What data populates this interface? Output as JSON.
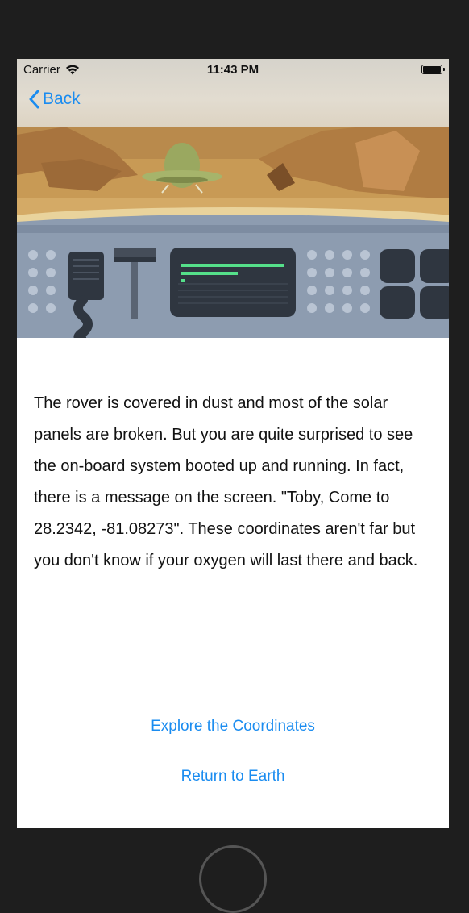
{
  "status_bar": {
    "carrier": "Carrier",
    "time": "11:43 PM"
  },
  "nav": {
    "back_label": "Back"
  },
  "hero": {
    "icon": "mars-rover-cockpit-illustration"
  },
  "story": {
    "text": "The rover is covered in dust and most of the solar panels are broken. But you are quite surprised to see the on-board system booted up and running. In fact, there is a message on the screen. \"Toby, Come to 28.2342, -81.08273\". These coordinates aren't far but you don't know if your oxygen will last there and back."
  },
  "actions": {
    "explore_label": "Explore the Coordinates",
    "return_label": "Return to Earth"
  },
  "colors": {
    "accent": "#1a8cf0",
    "background": "#1e1e1e"
  }
}
